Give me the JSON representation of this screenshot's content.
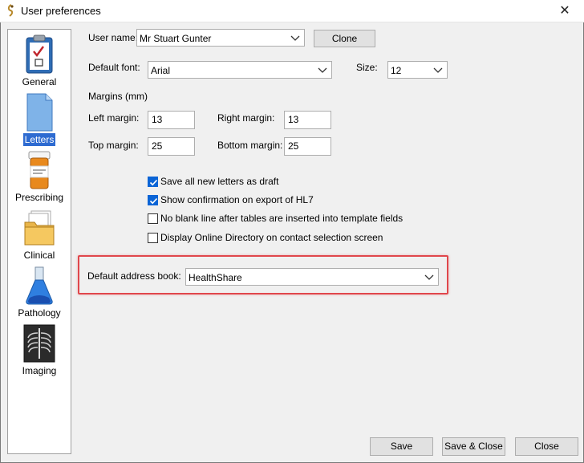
{
  "window": {
    "title": "User preferences",
    "close_symbol": "✕"
  },
  "sidebar": {
    "items": [
      {
        "label": "General",
        "icon": "clipboard-icon",
        "selected": false
      },
      {
        "label": "Letters",
        "icon": "document-icon",
        "selected": true
      },
      {
        "label": "Prescribing",
        "icon": "pill-bottle-icon",
        "selected": false
      },
      {
        "label": "Clinical",
        "icon": "folder-icon",
        "selected": false
      },
      {
        "label": "Pathology",
        "icon": "flask-icon",
        "selected": false
      },
      {
        "label": "Imaging",
        "icon": "xray-icon",
        "selected": false
      }
    ]
  },
  "form": {
    "user_name_label": "User name:",
    "user_name_value": "Mr Stuart Gunter",
    "clone_label": "Clone",
    "default_font_label": "Default font:",
    "default_font_value": "Arial",
    "size_label": "Size:",
    "size_value": "12",
    "margins_heading": "Margins (mm)",
    "left_margin_label": "Left margin:",
    "left_margin_value": "13",
    "right_margin_label": "Right margin:",
    "right_margin_value": "13",
    "top_margin_label": "Top margin:",
    "top_margin_value": "25",
    "bottom_margin_label": "Bottom margin:",
    "bottom_margin_value": "25",
    "checkboxes": [
      {
        "label": "Save all new letters as draft",
        "checked": true
      },
      {
        "label": "Show confirmation on export of HL7",
        "checked": true
      },
      {
        "label": "No blank line after tables are inserted into template fields",
        "checked": false
      },
      {
        "label": "Display Online Directory on contact selection screen",
        "checked": false
      }
    ],
    "address_book_label": "Default address book:",
    "address_book_value": "HealthShare"
  },
  "footer": {
    "save_label": "Save",
    "save_close_label": "Save & Close",
    "close_label": "Close"
  },
  "colors": {
    "selection": "#2e6bd1",
    "checkbox": "#0a64d6",
    "highlight": "#e0474c"
  }
}
